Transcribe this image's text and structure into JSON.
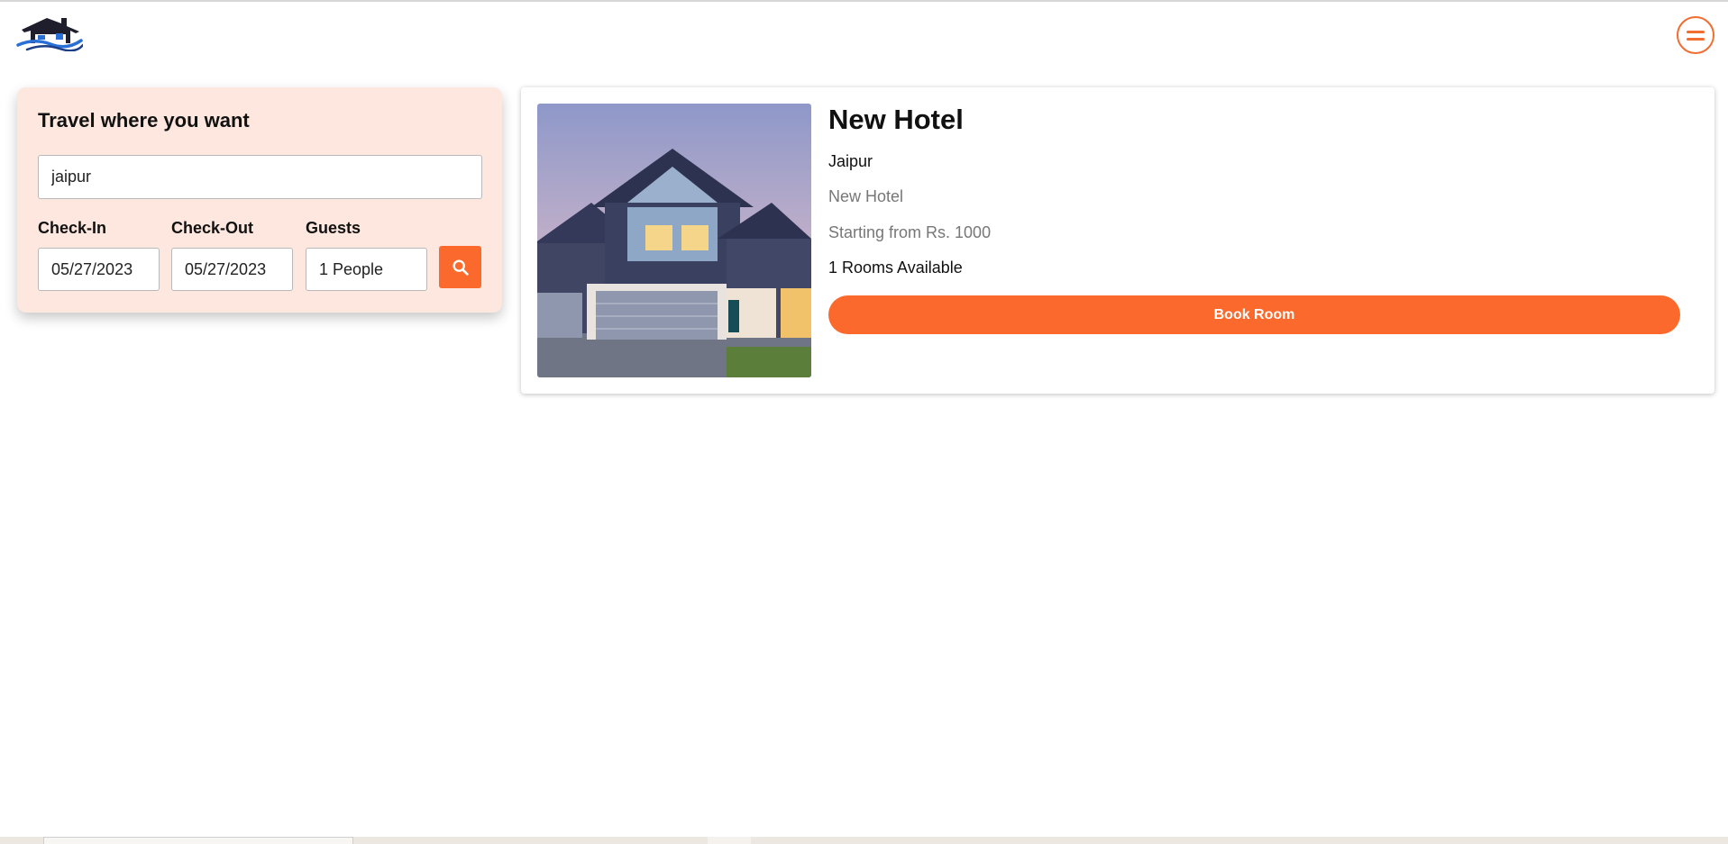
{
  "header": {
    "logo_icon": "house-logo-icon",
    "menu_icon": "hamburger-menu-icon"
  },
  "search": {
    "title": "Travel where you want",
    "location_value": "jaipur",
    "checkin_label": "Check-In",
    "checkin_value": "05/27/2023",
    "checkout_label": "Check-Out",
    "checkout_value": "05/27/2023",
    "guests_label": "Guests",
    "guests_value": "1 People",
    "search_icon": "search-icon"
  },
  "hotel": {
    "name": "New Hotel",
    "city": "Jaipur",
    "description": "New Hotel",
    "price": "Starting from Rs. 1000",
    "rooms": "1 Rooms Available",
    "book_label": "Book Room",
    "image_icon": "house-photo"
  },
  "colors": {
    "accent": "#fb6a2c",
    "search_card_bg": "#fde7de",
    "muted_text": "#777777"
  }
}
